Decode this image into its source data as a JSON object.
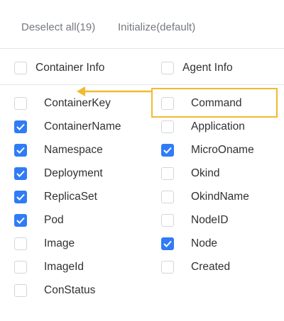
{
  "toolbar": {
    "deselect_label": "Deselect all(19)",
    "initialize_label": "Initialize(default)"
  },
  "header": {
    "container_info": {
      "label": "Container Info",
      "checked": false
    },
    "agent_info": {
      "label": "Agent Info",
      "checked": false
    }
  },
  "container_fields": [
    {
      "label": "ContainerKey",
      "checked": false
    },
    {
      "label": "ContainerName",
      "checked": true
    },
    {
      "label": "Namespace",
      "checked": true
    },
    {
      "label": "Deployment",
      "checked": true
    },
    {
      "label": "ReplicaSet",
      "checked": true
    },
    {
      "label": "Pod",
      "checked": true
    },
    {
      "label": "Image",
      "checked": false
    },
    {
      "label": "ImageId",
      "checked": false
    },
    {
      "label": "ConStatus",
      "checked": false
    }
  ],
  "agent_fields": [
    {
      "label": "Command",
      "checked": false
    },
    {
      "label": "Application",
      "checked": false
    },
    {
      "label": "MicroOname",
      "checked": true
    },
    {
      "label": "Okind",
      "checked": false
    },
    {
      "label": "OkindName",
      "checked": false
    },
    {
      "label": "NodeID",
      "checked": false
    },
    {
      "label": "Node",
      "checked": true
    },
    {
      "label": "Created",
      "checked": false
    }
  ],
  "colors": {
    "accent": "#2f7cf6",
    "highlight": "#f2b933"
  }
}
